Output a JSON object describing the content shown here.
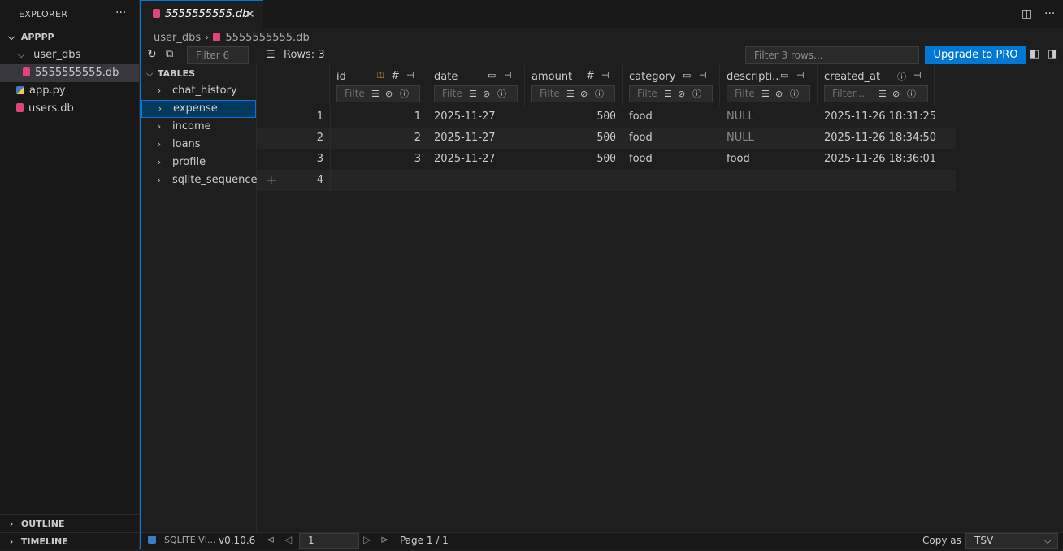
{
  "explorer": {
    "header": "EXPLORER",
    "more": "···",
    "root": "APPPP",
    "folder": "user_dbs",
    "selected_file": "5555555555.db",
    "files": [
      "app.py",
      "users.db"
    ],
    "outline": "OUTLINE",
    "timeline": "TIMELINE"
  },
  "editor": {
    "tab_label": "5555555555.db",
    "breadcrumb": [
      "user_dbs",
      "5555555555.db"
    ]
  },
  "sqlite": {
    "filter_tables_placeholder": "Filter 6",
    "tables_header": "TABLES",
    "tables": [
      "chat_history",
      "expense",
      "income",
      "loans",
      "profile",
      "sqlite_sequence"
    ],
    "selected_table": "expense",
    "rows_label": "Rows: 3",
    "filter_rows_placeholder": "Filter 3 rows...",
    "upgrade_label": "Upgrade to PRO",
    "columns": [
      {
        "name": "id",
        "filter": "Filte"
      },
      {
        "name": "date",
        "filter": "Filte"
      },
      {
        "name": "amount",
        "filter": "Filte"
      },
      {
        "name": "category",
        "filter": "Filte"
      },
      {
        "name": "descripti...",
        "filter": "Filte"
      },
      {
        "name": "created_at",
        "filter": "Filter..."
      }
    ],
    "rows": [
      {
        "n": "1",
        "id": "1",
        "date": "2025-11-27",
        "amount": "500",
        "category": "food",
        "description": "NULL",
        "created_at": "2025-11-26 18:31:25"
      },
      {
        "n": "2",
        "id": "2",
        "date": "2025-11-27",
        "amount": "500",
        "category": "food",
        "description": "NULL",
        "created_at": "2025-11-26 18:34:50"
      },
      {
        "n": "3",
        "id": "3",
        "date": "2025-11-27",
        "amount": "500",
        "category": "food",
        "description": "food",
        "created_at": "2025-11-26 18:36:01"
      }
    ],
    "new_row_number": "4",
    "footer": {
      "brand": "SQLITE VI...",
      "version": "v0.10.6",
      "page_value": "1",
      "page_label": "Page 1 / 1",
      "copy_as": "Copy as",
      "copy_format": "TSV"
    }
  },
  "colors": {
    "accent": "#0078d4",
    "db_icon": "#e0457b",
    "key_icon": "#e8a33c"
  }
}
